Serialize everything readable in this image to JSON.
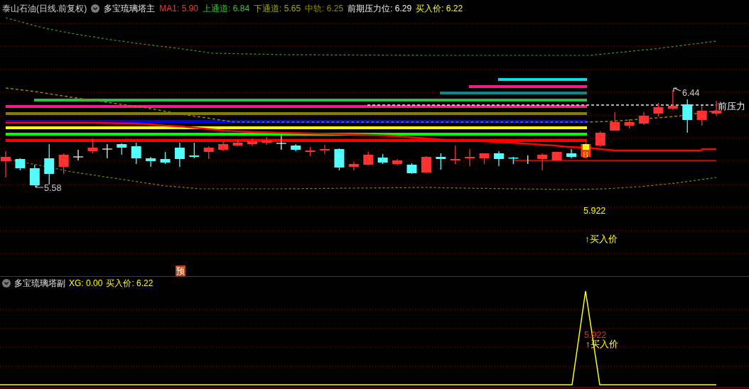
{
  "main_chart": {
    "title": "泰山石油(日线.前复权)",
    "indicator_name": "多宝琉璃塔主",
    "readouts": [
      {
        "text": "MA1: 5.90",
        "color": "#ff3333"
      },
      {
        "text": "上通道: 6.84",
        "color": "#33cc33"
      },
      {
        "text": "下通道: 5.65",
        "color": "#a8a800"
      },
      {
        "text": "中轨: 6.25",
        "color": "#8c8c00"
      },
      {
        "text": "前期压力位: 6.29",
        "color": "#f0f0f0"
      },
      {
        "text": "买入价: 6.22",
        "color": "#ffff00"
      }
    ],
    "high_label": "6.44",
    "low_label": "5.58",
    "resistance_label": "前压力",
    "signal_marker": "B",
    "buy_value": "5.922",
    "buy_label": "↑买入价",
    "forecast_badge": "预"
  },
  "sub_chart": {
    "indicator_name": "多宝琉璃塔副",
    "readouts": [
      {
        "text": "XG: 0.00",
        "color": "#ffff00"
      },
      {
        "text": "买入价: 6.22",
        "color": "#ffff00"
      }
    ],
    "buy_value": "5.922",
    "buy_label": "↑买入价"
  }
}
